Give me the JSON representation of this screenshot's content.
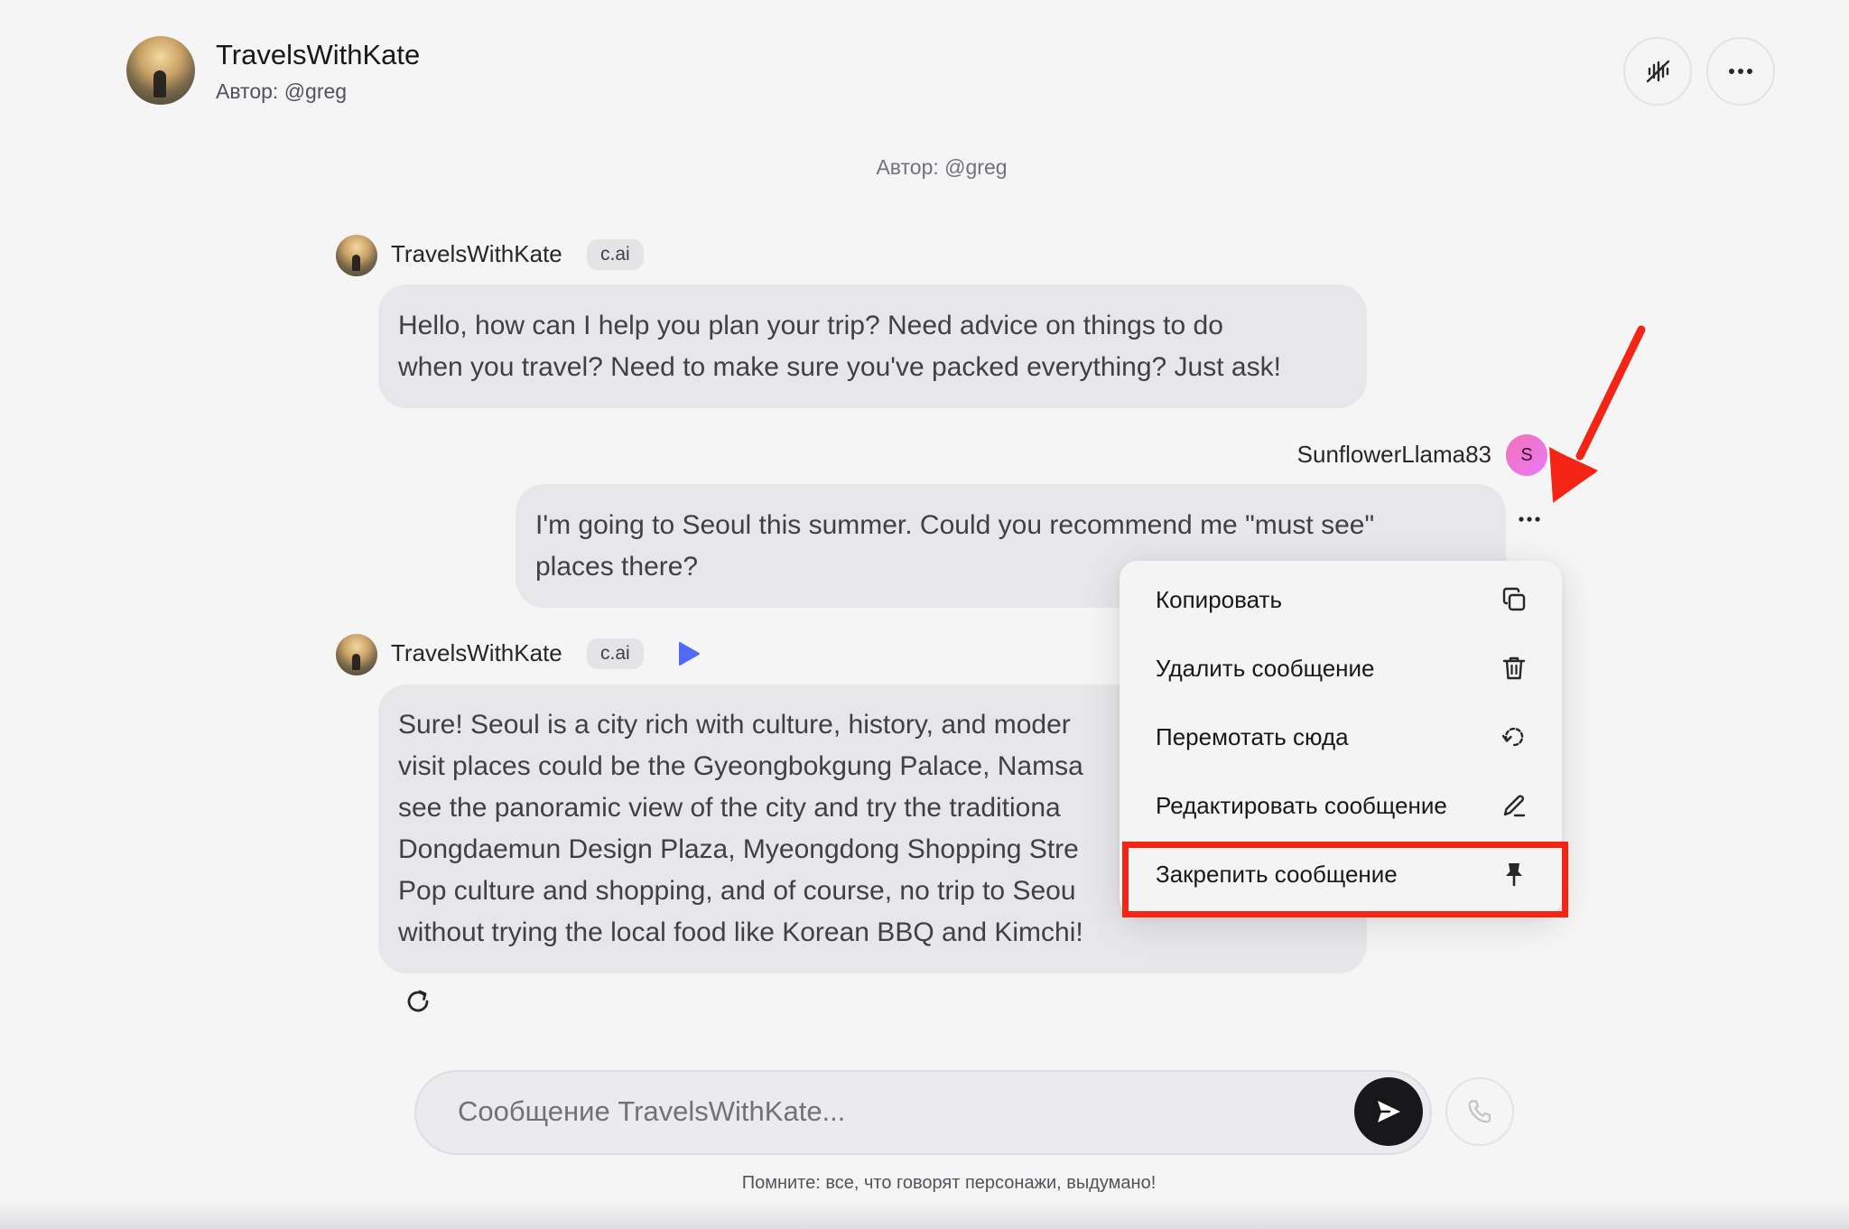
{
  "header": {
    "name": "TravelsWithKate",
    "author": "Автор: @greg",
    "waveform_icon": "voice-waveform-icon",
    "more_icon": "more-horizontal-icon"
  },
  "center_author": "Автор: @greg",
  "messages": [
    {
      "sender": "TravelsWithKate",
      "badge": "c.ai",
      "text_lines": [
        "Hello, how can I help you plan your trip? Need advice on things to do",
        "when you travel? Need to make sure you've packed everything? Just ask!"
      ]
    },
    {
      "sender": "SunflowerLlama83",
      "avatar_letter": "S",
      "text_lines": [
        "I'm going to Seoul this summer. Could you recommend me \"must see\"",
        "places there?"
      ]
    },
    {
      "sender": "TravelsWithKate",
      "badge": "c.ai",
      "text_lines": [
        "Sure! Seoul is a city rich with culture, history, and moder",
        "visit places could be the Gyeongbokgung Palace, Namsa",
        "see the panoramic view of the city and try the traditiona",
        "Dongdaemun Design Plaza, Myeongdong Shopping Stre",
        "Pop culture and shopping, and of course, no trip to Seou",
        "without trying the local food like Korean BBQ and Kimchi!"
      ]
    }
  ],
  "context_menu": {
    "items": [
      {
        "label": "Копировать",
        "icon": "copy-icon"
      },
      {
        "label": "Удалить сообщение",
        "icon": "trash-icon"
      },
      {
        "label": "Перемотать сюда",
        "icon": "rewind-icon"
      },
      {
        "label": "Редактировать сообщение",
        "icon": "pencil-icon"
      },
      {
        "label": "Закрепить сообщение",
        "icon": "pin-icon"
      }
    ],
    "highlighted_item": "Закрепить сообщение"
  },
  "input": {
    "placeholder": "Сообщение TravelsWithKate..."
  },
  "disclaimer": "Помните: все, что говорят персонажи, выдумано!",
  "colors": {
    "background": "#f5f5f6",
    "bubble": "#e7e7ea",
    "annotation_red": "#f42514",
    "play_blue": "#4f6bf5",
    "user_avatar_pink": "#f472b6"
  }
}
